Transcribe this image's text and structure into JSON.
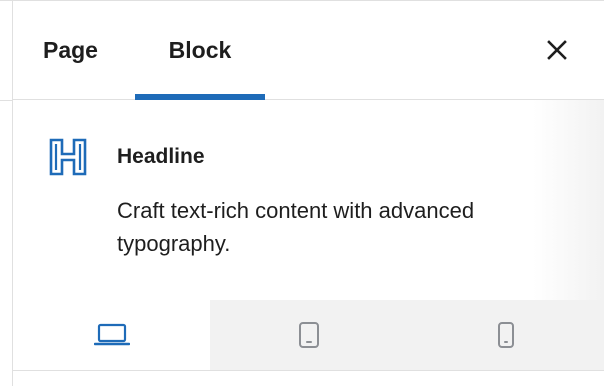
{
  "tabs": {
    "page_label": "Page",
    "block_label": "Block",
    "active": "Block"
  },
  "block": {
    "icon": "heading-icon",
    "title": "Headline",
    "description": "Craft text-rich content with advanced typography."
  },
  "devices": [
    {
      "name": "desktop",
      "icon": "desktop-icon",
      "active": true
    },
    {
      "name": "tablet",
      "icon": "tablet-icon",
      "active": false
    },
    {
      "name": "mobile",
      "icon": "mobile-icon",
      "active": false
    }
  ],
  "colors": {
    "accent": "#1e6bb8",
    "icon_inactive": "#8c8f94",
    "text": "#1e1e1e",
    "border": "#e0e0e0"
  }
}
